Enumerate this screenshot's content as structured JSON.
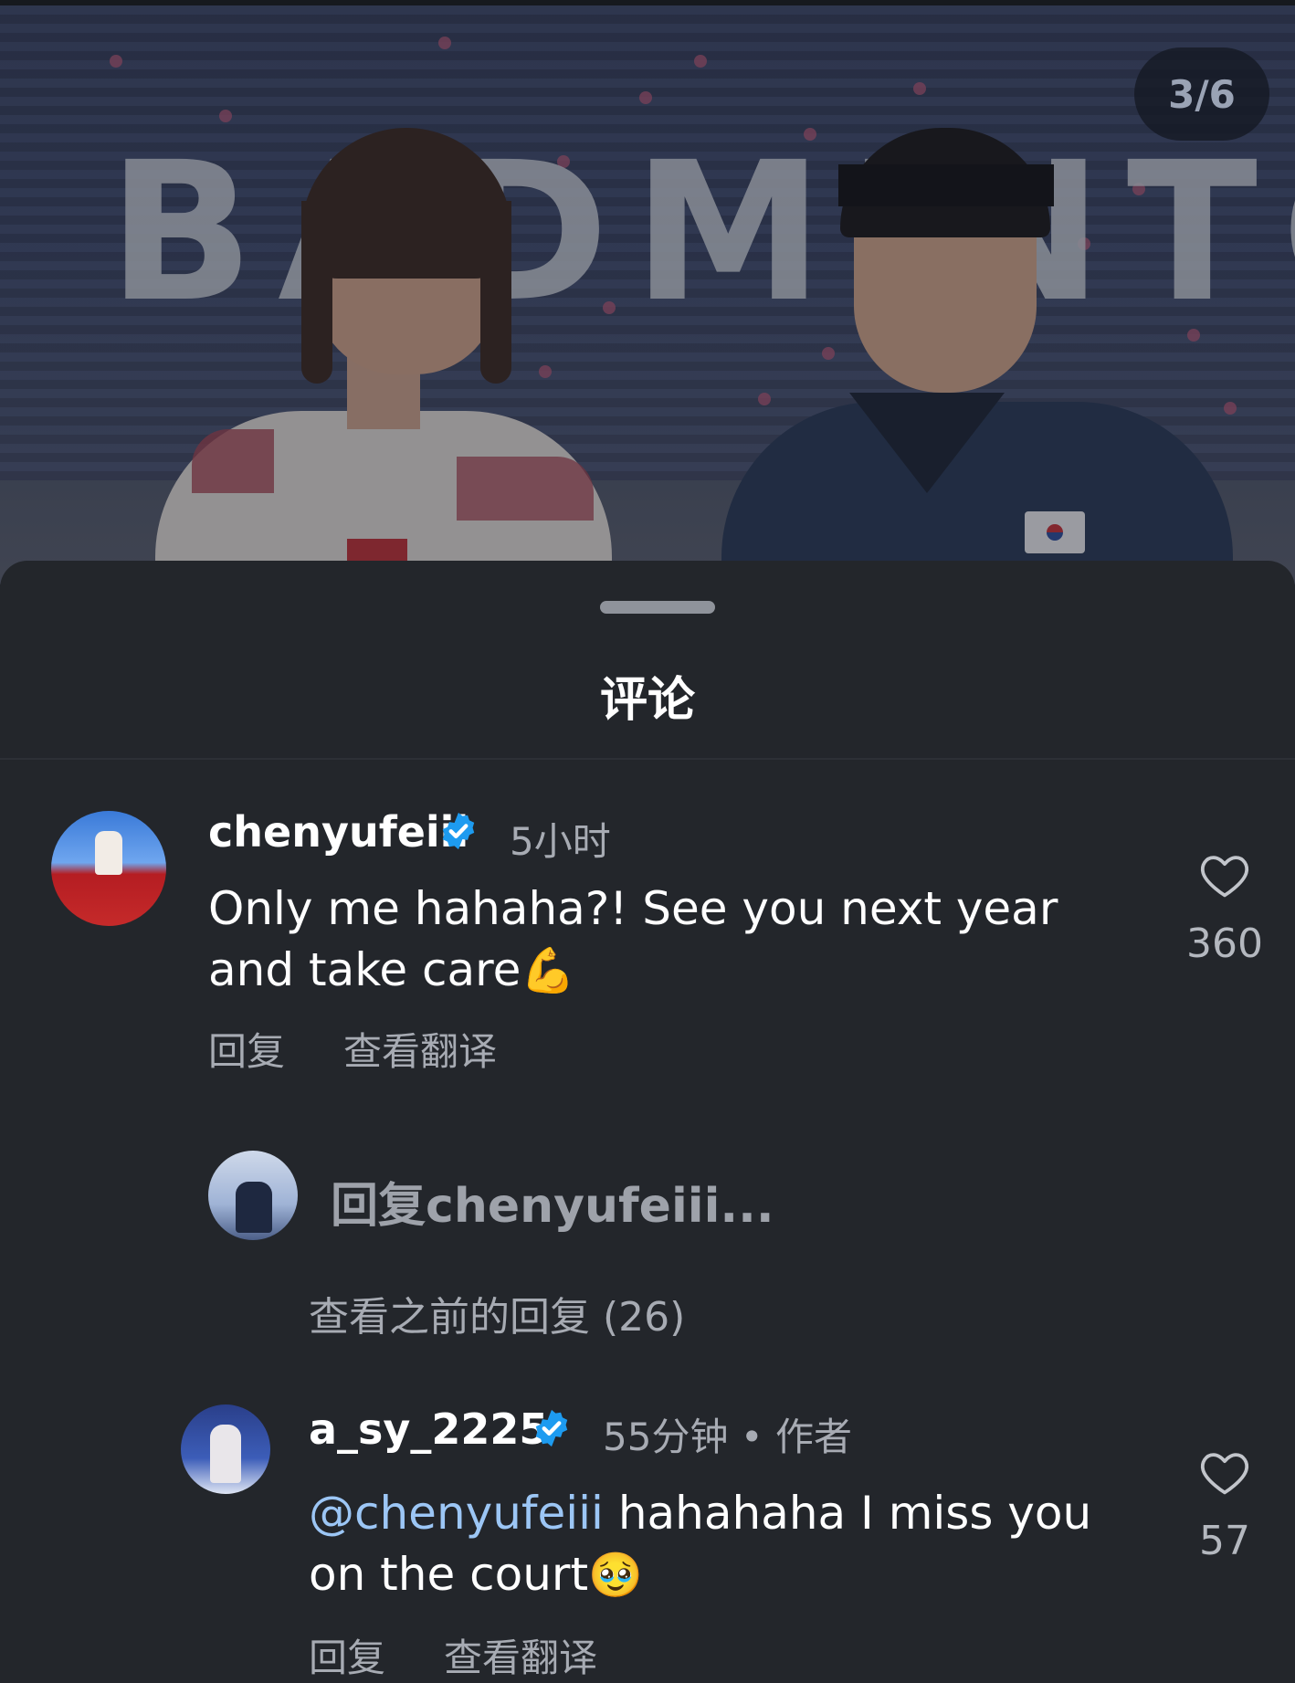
{
  "photo": {
    "counter": "3/6",
    "banner_text": "BADMINTO"
  },
  "sheet": {
    "title": "评论"
  },
  "comments": [
    {
      "username": "chenyufeiii",
      "time": "5小时",
      "text": "Only me hahaha?! See you next year and take care",
      "emoji": "💪",
      "reply_label": "回复",
      "translate_label": "查看翻译",
      "likes": "360"
    },
    {
      "username": "a_sy_2225",
      "time": "55分钟",
      "separator": "•",
      "author_badge": "作者",
      "mention": "@chenyufeiii",
      "text": " hahahaha I miss you on the court",
      "emoji": "🥹",
      "reply_label": "回复",
      "translate_label": "查看翻译",
      "likes": "57"
    }
  ],
  "reply_input": {
    "placeholder": "回复chenyufeiii..."
  },
  "view_previous": "查看之前的回复 (26)",
  "icons": {
    "verified": "verified-badge-icon",
    "like": "heart-outline-icon"
  },
  "colors": {
    "sheet_bg": "#23262b",
    "verified_blue": "#1d9bf0",
    "mention": "#9cc6f5",
    "muted_text": "#a7abb3"
  }
}
